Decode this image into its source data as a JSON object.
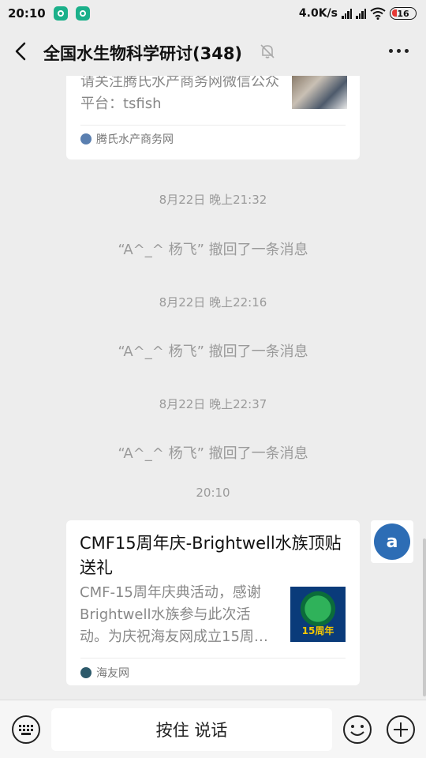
{
  "status_bar": {
    "time": "20:10",
    "network_speed": "4.0K/s",
    "signal_label_1": "HD",
    "signal_label_2": "HD",
    "battery": "16"
  },
  "nav": {
    "title": "全国水生物科学研讨(348)"
  },
  "messages": {
    "card1": {
      "description": "请关注腾氏水产商务网微信公众平台：tsfish",
      "source": "腾氏水产商务网"
    },
    "ts1": "8月22日 晚上21:32",
    "recall1": "“A^_^ 杨飞” 撤回了一条消息",
    "ts2": "8月22日 晚上22:16",
    "recall2": "“A^_^ 杨飞” 撤回了一条消息",
    "ts3": "8月22日 晚上22:37",
    "recall3": "“A^_^ 杨飞” 撤回了一条消息",
    "ts4": "20:10",
    "card2": {
      "title": "CMF15周年庆-Brightwell水族顶贴送礼",
      "description": "CMF-15周年庆典活动，感谢Brightwell水族参与此次活动。为庆祝海友网成立15周…",
      "thumb_text": "15周年",
      "source": "海友网"
    }
  },
  "input": {
    "hold_to_talk": "按住 说话"
  },
  "colors": {
    "background": "#ededed",
    "card": "#ffffff",
    "muted_text": "#9a9a9a",
    "wechat_green": "#1bb08a"
  }
}
